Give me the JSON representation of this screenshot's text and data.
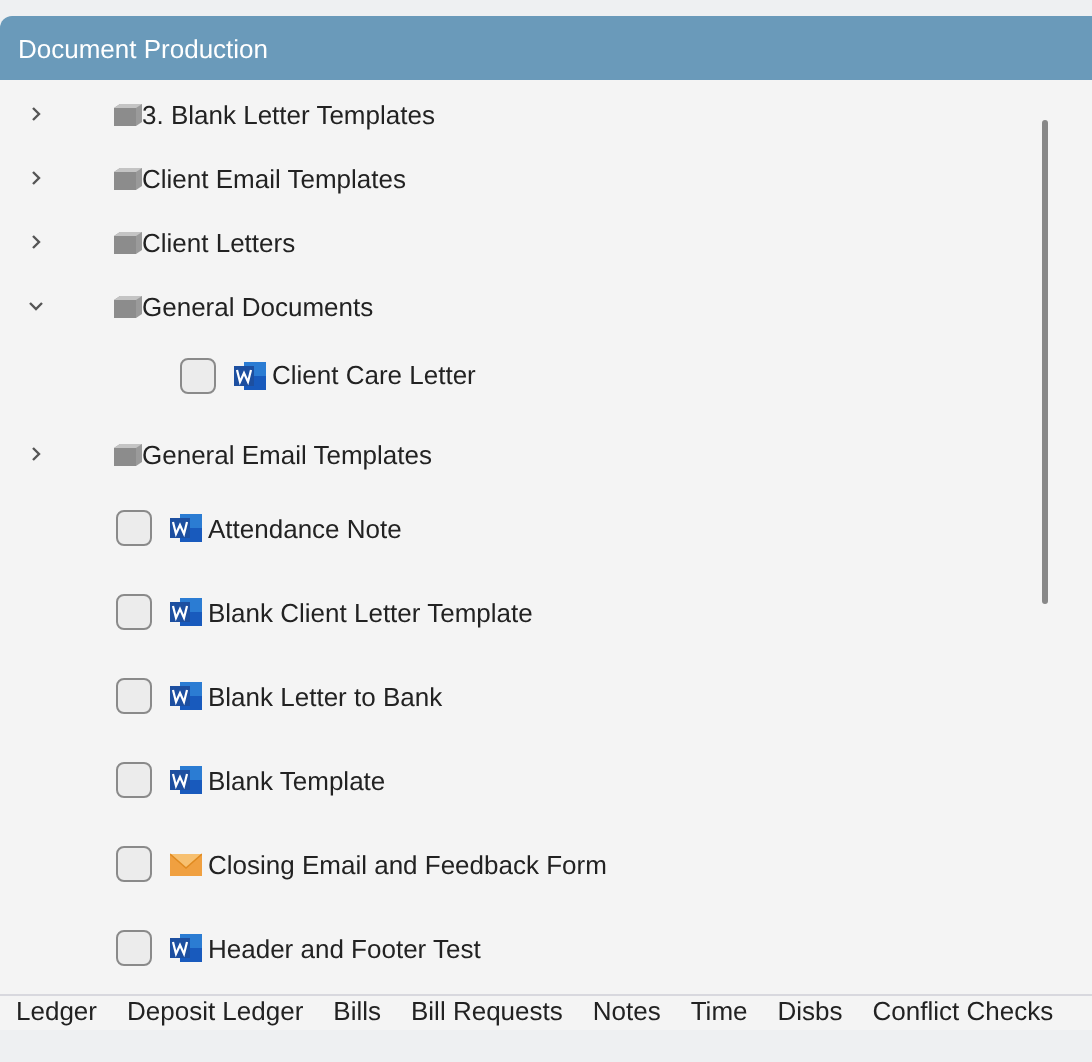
{
  "panel": {
    "title": "Document Production"
  },
  "tree": [
    {
      "kind": "folder",
      "label": "3. Blank Letter Templates",
      "expanded": false
    },
    {
      "kind": "folder",
      "label": "Client Email Templates",
      "expanded": false
    },
    {
      "kind": "folder",
      "label": "Client Letters",
      "expanded": false
    },
    {
      "kind": "folder",
      "label": "General Documents",
      "expanded": true,
      "children": [
        {
          "kind": "word",
          "label": "Client Care Letter",
          "checked": false
        }
      ]
    },
    {
      "kind": "folder",
      "label": "General Email Templates",
      "expanded": false
    },
    {
      "kind": "word",
      "label": "Attendance Note",
      "checked": false
    },
    {
      "kind": "word",
      "label": "Blank Client Letter Template",
      "checked": false
    },
    {
      "kind": "word",
      "label": "Blank Letter to Bank",
      "checked": false
    },
    {
      "kind": "word",
      "label": "Blank Template",
      "checked": false
    },
    {
      "kind": "email",
      "label": "Closing Email and Feedback Form",
      "checked": false
    },
    {
      "kind": "word",
      "label": "Header and Footer Test",
      "checked": false
    }
  ],
  "tabs": [
    {
      "label": "Ledger",
      "selected": false
    },
    {
      "label": "Deposit Ledger",
      "selected": false
    },
    {
      "label": "Bills",
      "selected": false
    },
    {
      "label": "Bill Requests",
      "selected": false
    },
    {
      "label": "Notes",
      "selected": false
    },
    {
      "label": "Time",
      "selected": false
    },
    {
      "label": "Disbs",
      "selected": false
    },
    {
      "label": "Conflict Checks",
      "selected": false
    }
  ]
}
